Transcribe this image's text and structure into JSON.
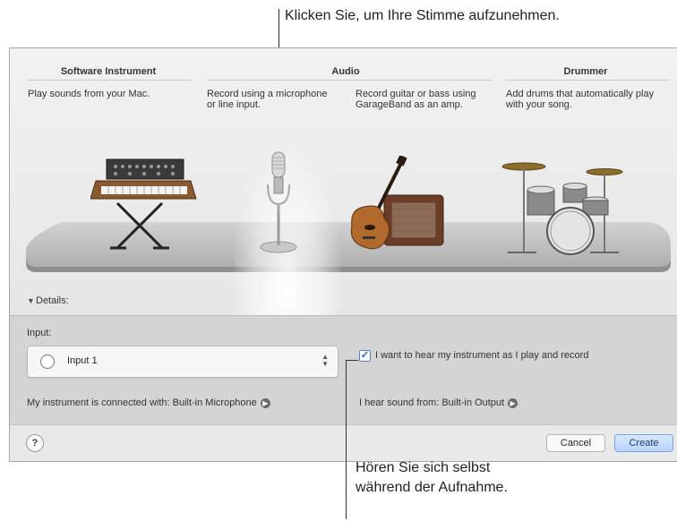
{
  "callouts": {
    "top": "Klicken Sie, um Ihre Stimme aufzunehmen.",
    "bottom_line1": "Hören Sie sich selbst",
    "bottom_line2": "während der Aufnahme."
  },
  "categories": {
    "software_instrument": {
      "title": "Software Instrument",
      "description": "Play sounds from your Mac."
    },
    "audio": {
      "title": "Audio",
      "mic_description_line1": "Record using a microphone",
      "mic_description_line2": "or line input.",
      "guitar_description_line1": "Record guitar or bass using",
      "guitar_description_line2": "GarageBand as an amp."
    },
    "drummer": {
      "title": "Drummer",
      "description_line1": "Add drums that automatically play",
      "description_line2": "with your song."
    }
  },
  "details": {
    "toggle_glyph": "▼",
    "label": "Details:"
  },
  "input_panel": {
    "input_label": "Input:",
    "selected_input": "Input 1",
    "stepper_up": "▲",
    "stepper_down": "▼",
    "monitor_checked": true,
    "check_glyph": "✓",
    "monitor_label": "I want to hear my instrument as I play and record",
    "connected_label": "My instrument is connected with: Built-in Microphone",
    "output_label": "I hear sound from: Built-in Output",
    "arrow_glyph": "▶"
  },
  "footer": {
    "help_label": "?",
    "cancel_label": "Cancel",
    "create_label": "Create"
  },
  "colors": {
    "accent": "#1d5fc6",
    "create_button": "#b7d3f7",
    "panel_bg": "#d4d4d4",
    "stage": "#b8b8b8"
  },
  "icons": [
    "synthesizer-icon",
    "microphone-icon",
    "guitar-amp-icon",
    "drum-kit-icon",
    "question-icon",
    "arrow-circle-icon",
    "checkbox-icon",
    "radio-icon",
    "stepper-icon",
    "disclosure-triangle-icon"
  ]
}
